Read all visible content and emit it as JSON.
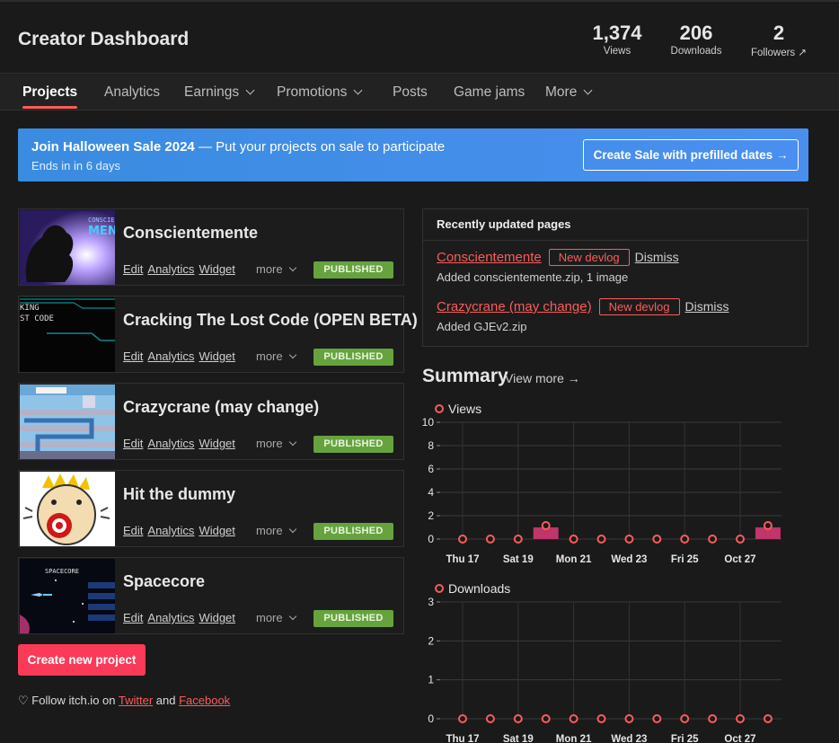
{
  "header": {
    "title": "Creator Dashboard",
    "stats": [
      {
        "value": "1,374",
        "label": "Views"
      },
      {
        "value": "206",
        "label": "Downloads"
      },
      {
        "value": "2",
        "label": "Followers ↗"
      }
    ]
  },
  "nav": {
    "tabs": [
      {
        "label": "Projects",
        "active": true,
        "dropdown": false
      },
      {
        "label": "Analytics",
        "dropdown": false
      },
      {
        "label": "Earnings",
        "dropdown": true
      },
      {
        "label": "Promotions",
        "dropdown": true
      },
      {
        "label": "Posts",
        "dropdown": false
      },
      {
        "label": "Game jams",
        "dropdown": false
      },
      {
        "label": "More",
        "dropdown": true
      }
    ]
  },
  "banner": {
    "title_bold": "Join Halloween Sale 2024",
    "title_rest": " — Put your projects on sale to participate",
    "subtitle": "Ends in in 6 days",
    "button": "Create Sale with prefilled dates →"
  },
  "projects": [
    {
      "name": "Conscientemente",
      "links": [
        "Edit",
        "Analytics",
        "Widget"
      ],
      "more": "more",
      "status": "PUBLISHED"
    },
    {
      "name": "Cracking The Lost Code (OPEN BETA)",
      "links": [
        "Edit",
        "Analytics",
        "Widget"
      ],
      "more": "more",
      "status": "PUBLISHED"
    },
    {
      "name": "Crazycrane (may change)",
      "links": [
        "Edit",
        "Analytics",
        "Widget"
      ],
      "more": "more",
      "status": "PUBLISHED"
    },
    {
      "name": "Hit the dummy",
      "links": [
        "Edit",
        "Analytics",
        "Widget"
      ],
      "more": "more",
      "status": "PUBLISHED"
    },
    {
      "name": "Spacecore",
      "links": [
        "Edit",
        "Analytics",
        "Widget"
      ],
      "more": "more",
      "status": "PUBLISHED"
    }
  ],
  "create_button": "Create new project",
  "follow": {
    "prefix": "Follow itch.io on ",
    "twitter": "Twitter",
    "and": " and ",
    "facebook": "Facebook"
  },
  "recent": {
    "heading": "Recently updated pages",
    "items": [
      {
        "title": "Conscientemente",
        "badge": "New devlog",
        "dismiss": "Dismiss",
        "desc": "Added conscientemente.zip, 1 image"
      },
      {
        "title": "Crazycrane (may change)",
        "badge": "New devlog",
        "dismiss": "Dismiss",
        "desc": "Added GJEv2.zip"
      }
    ]
  },
  "summary": {
    "heading": "Summary",
    "view_more": "View more →"
  },
  "colors": {
    "accent": "#fa5c5c",
    "published": "#66a33f",
    "banner": "#3d8be6",
    "bar": "#c0356a"
  },
  "chart_data": [
    {
      "type": "line",
      "title": "Views",
      "x": [
        "Oct 17",
        "Oct 18",
        "Oct 19",
        "Oct 20",
        "Oct 21",
        "Oct 22",
        "Oct 23",
        "Oct 24",
        "Oct 25",
        "Oct 26",
        "Oct 27",
        "Oct 28"
      ],
      "tick_labels": [
        "Thu 17",
        "Sat 19",
        "Mon 21",
        "Wed 23",
        "Fri 25",
        "Oct 27"
      ],
      "values": [
        0,
        0,
        0,
        1,
        0,
        0,
        0,
        0,
        0,
        0,
        0,
        1
      ],
      "ylim": [
        0,
        10
      ],
      "yticks": [
        0,
        2,
        4,
        6,
        8,
        10
      ],
      "grid": true
    },
    {
      "type": "line",
      "title": "Downloads",
      "x": [
        "Oct 17",
        "Oct 18",
        "Oct 19",
        "Oct 20",
        "Oct 21",
        "Oct 22",
        "Oct 23",
        "Oct 24",
        "Oct 25",
        "Oct 26",
        "Oct 27",
        "Oct 28"
      ],
      "tick_labels": [
        "Thu 17",
        "Sat 19",
        "Mon 21",
        "Wed 23",
        "Fri 25",
        "Oct 27"
      ],
      "values": [
        0,
        0,
        0,
        0,
        0,
        0,
        0,
        0,
        0,
        0,
        0,
        0
      ],
      "ylim": [
        0,
        3
      ],
      "yticks": [
        0,
        1,
        2,
        3
      ],
      "grid": true
    }
  ]
}
